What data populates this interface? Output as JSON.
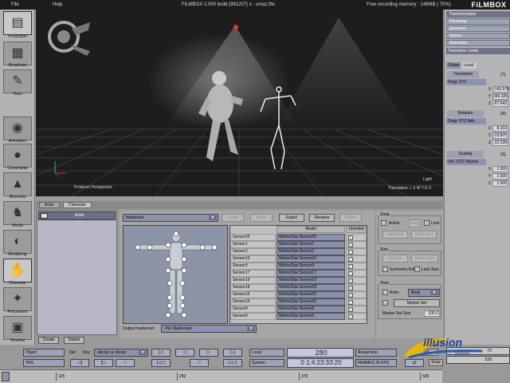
{
  "menubar": {
    "file": "File",
    "help": "Help",
    "title": "FILMBOX 2.000 build (991207) x - smaz.fbx",
    "memory": "Free recording memory : 148MB ( 70%)",
    "brand": "FiLMBOX"
  },
  "toolbar": {
    "items": [
      {
        "label": "Production",
        "icon": "film-icon"
      },
      {
        "label": "Broadcast",
        "icon": "broadcast-icon"
      },
      {
        "label": "Tools",
        "icon": "tools-icon"
      },
      {
        "label": "Animation",
        "icon": "animation-icon"
      },
      {
        "label": "Constraints",
        "icon": "constraints-icon"
      },
      {
        "label": "Elements",
        "icon": "elements-icon"
      },
      {
        "label": "Media",
        "icon": "media-icon"
      },
      {
        "label": "Rendering",
        "icon": "rendering-icon"
      },
      {
        "label": "Character",
        "icon": "character-icon"
      },
      {
        "label": "Processors",
        "icon": "processors-icon"
      },
      {
        "label": "Timeline",
        "icon": "timeline-icon"
      }
    ]
  },
  "viewport": {
    "camera_label": "Producer Perspective",
    "light_label": "Light",
    "mode_label": "Translation: L X M Y R Z"
  },
  "rightpanel": {
    "tabs": [
      "Transformation",
      "Parenting",
      "Elements",
      "Viewer",
      "Animation"
    ],
    "section": "Transform: Limits",
    "global": "Global",
    "local": "Local",
    "translation": {
      "label": "Translation",
      "key": "(T)",
      "drag": "Drag: XYZ",
      "x": "-143.578",
      "y": "346.326",
      "z": "-67.642"
    },
    "rotation": {
      "label": "Rotation",
      "key": "(R)",
      "drag": "Drag: XYZ   Axis",
      "x": "8.333",
      "y": "-23.875",
      "z": "22.228"
    },
    "scaling": {
      "label": "Scaling",
      "key": "(S)",
      "drag": "Uni: XYZ  Volume",
      "x": "1.000",
      "y": "1.000",
      "z": "1.000"
    }
  },
  "navtabs": {
    "actor": "Actor",
    "character": "Character"
  },
  "actorlist": {
    "item": "Actor",
    "create": "Create",
    "delete": "Delete"
  },
  "charpanel": {
    "markerset": "Markerset",
    "buttons": {
      "create": "Create",
      "insert": "Insert",
      "export": "Export",
      "rename": "Rename",
      "delete": "Delete"
    },
    "columns": {
      "model": "Model",
      "oriented": "Oriented"
    },
    "rows": [
      {
        "name": "Sensor20",
        "model": "MotionStar:Sensor20"
      },
      {
        "name": "Sensor1",
        "model": "MotionStar:Sensor1"
      },
      {
        "name": "Sensor2",
        "model": "MotionStar:Sensor2"
      },
      {
        "name": "Sensor10",
        "model": "MotionStar:Sensor10"
      },
      {
        "name": "Sensor5",
        "model": "MotionStar:Sensor5"
      },
      {
        "name": "Sensor17",
        "model": "MotionStar:Sensor17"
      },
      {
        "name": "Sensor19",
        "model": "MotionStar:Sensor19"
      },
      {
        "name": "Sensor18",
        "model": "MotionStar:Sensor18"
      },
      {
        "name": "Sensor15",
        "model": "MotionStar:Sensor15"
      },
      {
        "name": "Sensor16",
        "model": "MotionStar:Sensor16"
      },
      {
        "name": "Sensor8",
        "model": "MotionStar:Sensor8"
      },
      {
        "name": "Sensor6",
        "model": "MotionStar:Sensor6"
      }
    ],
    "output_label": "Output markerset:",
    "output_value": "<No Markerset>"
  },
  "options": {
    "snap": "Snap",
    "active": "Active",
    "snap_btn": "Snap",
    "lock": "Lock",
    "full_body": "Full Body",
    "body_part": "Body Part",
    "size": "Size",
    "fit_size": "Fit Size",
    "reset_size": "Reset Size",
    "symmetry_edit": "Symmetry Edit",
    "lock_size": "Lock Size",
    "view": "View",
    "actor": "Actor",
    "body": "Body",
    "marker_set": "Marker Set",
    "marker_set_size": "Marker Set Size",
    "marker_set_size_value": "100.0"
  },
  "transport": {
    "object": "Object",
    "del": "Del",
    "key": "Key",
    "dropdown": "ukroky se zbrani",
    "trs": "TRS",
    "local": "Local",
    "frame": "280",
    "actual_time": "Actual time",
    "system": "System",
    "timecode": "0 1:4:23:33:20",
    "fps": "FRAMES 25 FPS",
    "snap": "Snap",
    "set": "Set",
    "frame_a": "73",
    "frame_b": "539"
  },
  "timeline": {
    "ticks": [
      "125",
      "250",
      "375",
      "500"
    ]
  },
  "logo": {
    "text": "illusion",
    "sub": "software"
  }
}
